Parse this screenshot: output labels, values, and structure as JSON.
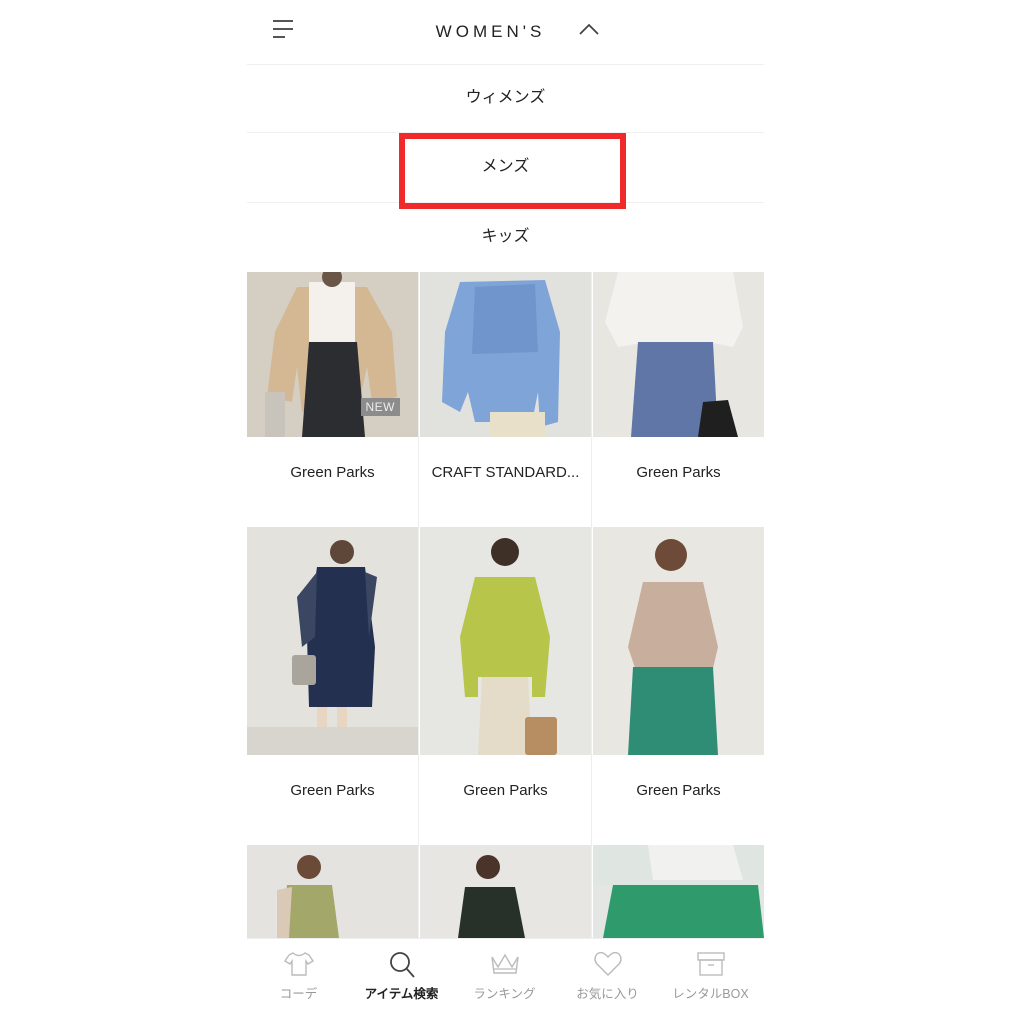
{
  "header": {
    "title": "WOMEN'S",
    "menu_icon": "hamburger-menu-icon",
    "toggle_icon": "chevron-up-icon"
  },
  "gender_menu": {
    "items": [
      {
        "label": "ウィメンズ"
      },
      {
        "label": "メンズ",
        "highlighted": true
      },
      {
        "label": "キッズ"
      }
    ],
    "highlight_color": "#f02a2a"
  },
  "products": [
    {
      "brand": "Green Parks",
      "badge": "NEW"
    },
    {
      "brand": "CRAFT STANDARD..."
    },
    {
      "brand": "Green Parks"
    },
    {
      "brand": "Green Parks"
    },
    {
      "brand": "Green Parks"
    },
    {
      "brand": "Green Parks"
    },
    {
      "brand": ""
    },
    {
      "brand": ""
    },
    {
      "brand": ""
    }
  ],
  "tabbar": {
    "tabs": [
      {
        "label": "コーデ",
        "icon": "tshirt-icon",
        "active": false
      },
      {
        "label": "アイテム検索",
        "icon": "search-icon",
        "active": true
      },
      {
        "label": "ランキング",
        "icon": "crown-icon",
        "active": false
      },
      {
        "label": "お気に入り",
        "icon": "heart-icon",
        "active": false
      },
      {
        "label": "レンタルBOX",
        "icon": "box-icon",
        "active": false
      }
    ]
  }
}
